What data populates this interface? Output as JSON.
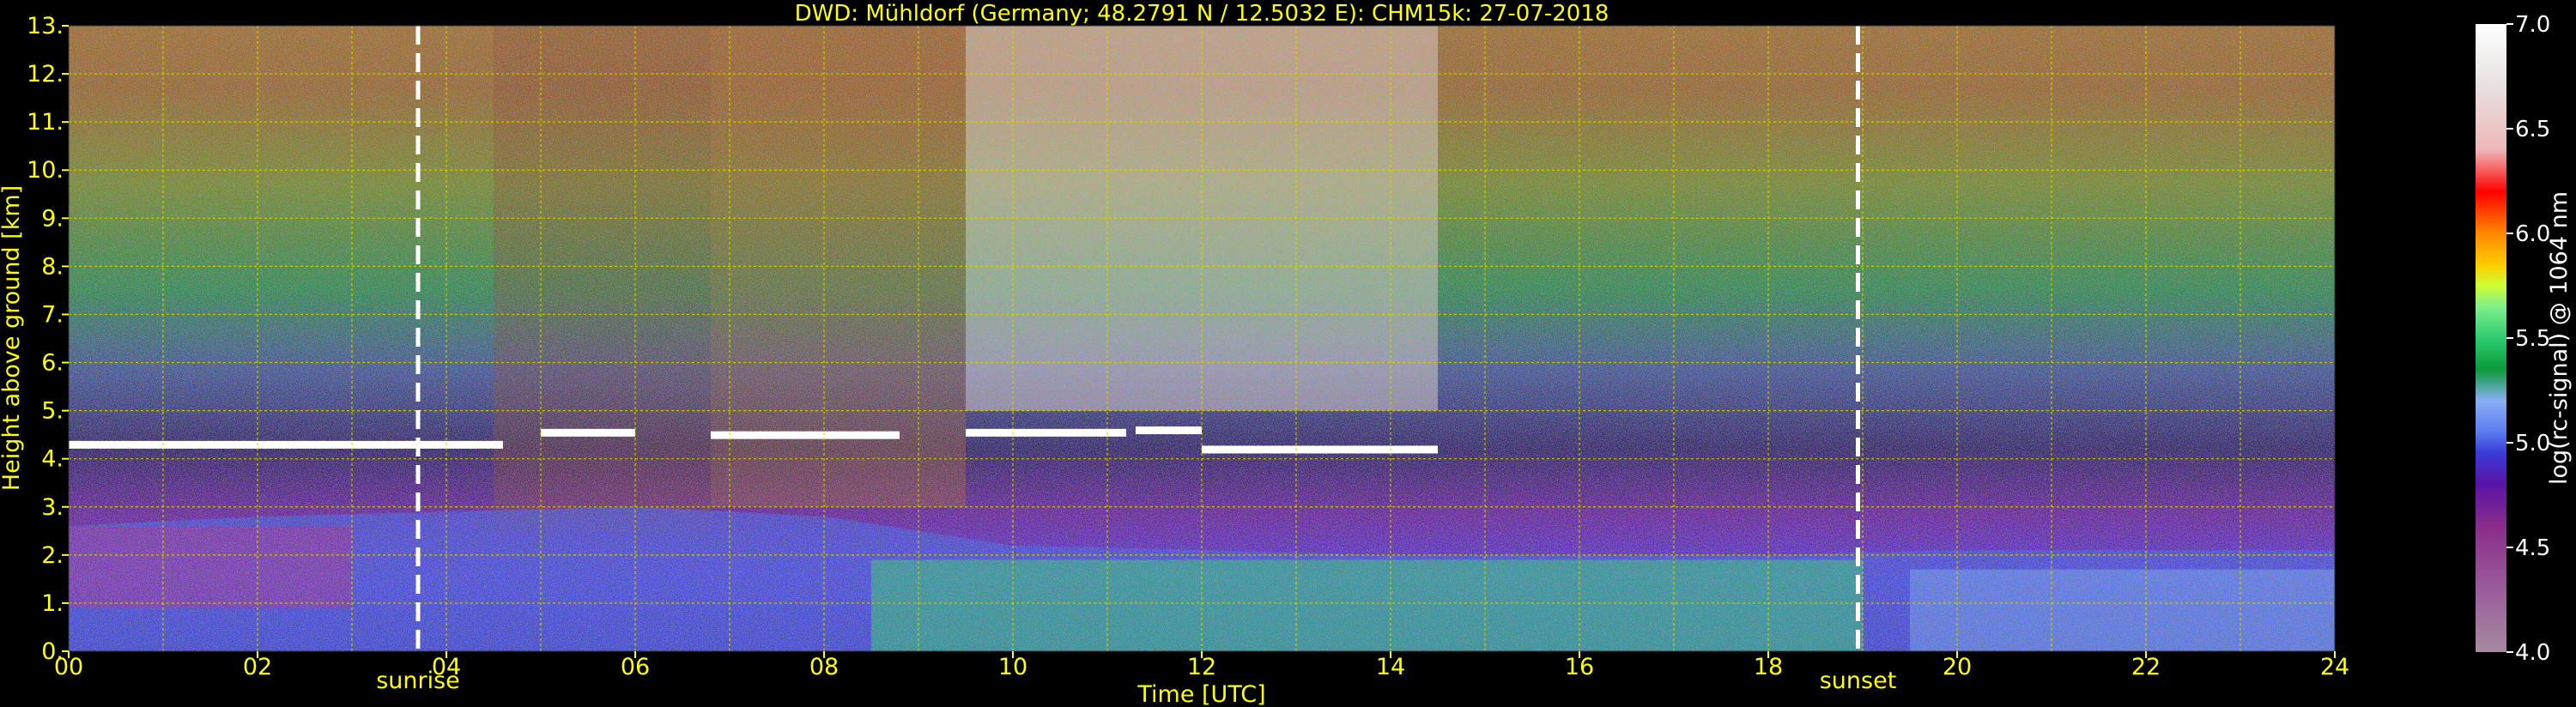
{
  "chart_data": {
    "type": "heatmap",
    "title": "DWD: Mühldorf (Germany; 48.2791 N / 12.5032 E):    CHM15k: 27-07-2018",
    "xlabel": "Time [UTC]",
    "ylabel": "Height above ground [km]",
    "colorbar_label": "log(rc-signal) @ 1064 nm",
    "xlim": [
      0,
      24
    ],
    "ylim": [
      0,
      13
    ],
    "x_ticks": [
      "00",
      "02",
      "04",
      "06",
      "08",
      "10",
      "12",
      "14",
      "16",
      "18",
      "20",
      "22",
      "24"
    ],
    "y_ticks": [
      "0.",
      "1.",
      "2.",
      "3.",
      "4.",
      "5.",
      "6.",
      "7.",
      "8.",
      "9.",
      "10.",
      "11.",
      "12.",
      "13."
    ],
    "colorbar_range": [
      4.0,
      7.0
    ],
    "colorbar_ticks": [
      "4.0",
      "4.5",
      "5.0",
      "5.5",
      "6.0",
      "6.5",
      "7.0"
    ],
    "grid": true,
    "events": [
      {
        "label": "sunrise",
        "x": 3.7
      },
      {
        "label": "sunset",
        "x": 18.95
      }
    ],
    "cloud_layers": [
      {
        "x_start": 0.0,
        "x_end": 4.6,
        "height": 4.3
      },
      {
        "x_start": 5.0,
        "x_end": 6.0,
        "height": 4.55
      },
      {
        "x_start": 6.8,
        "x_end": 8.8,
        "height": 4.5
      },
      {
        "x_start": 9.5,
        "x_end": 11.2,
        "height": 4.55
      },
      {
        "x_start": 11.3,
        "x_end": 12.0,
        "height": 4.6
      },
      {
        "x_start": 12.0,
        "x_end": 14.5,
        "height": 4.2
      }
    ],
    "boundary_layer": [
      {
        "x": 0,
        "top": 2.6
      },
      {
        "x": 2,
        "top": 2.8
      },
      {
        "x": 4,
        "top": 2.9
      },
      {
        "x": 6,
        "top": 3.0
      },
      {
        "x": 8,
        "top": 2.8
      },
      {
        "x": 10,
        "top": 2.2
      },
      {
        "x": 12,
        "top": 2.1
      },
      {
        "x": 14,
        "top": 2.0
      },
      {
        "x": 16,
        "top": 2.0
      },
      {
        "x": 18,
        "top": 2.0
      },
      {
        "x": 20,
        "top": 2.1
      },
      {
        "x": 22,
        "top": 2.1
      },
      {
        "x": 24,
        "top": 2.1
      }
    ],
    "colormap": [
      {
        "value": 4.0,
        "color": "#a68aa0"
      },
      {
        "value": 4.3,
        "color": "#9a5c9a"
      },
      {
        "value": 4.6,
        "color": "#8a2c8a"
      },
      {
        "value": 4.8,
        "color": "#5a14a6"
      },
      {
        "value": 4.95,
        "color": "#3a3ad8"
      },
      {
        "value": 5.05,
        "color": "#5a7cf0"
      },
      {
        "value": 5.2,
        "color": "#8aaef5"
      },
      {
        "value": 5.35,
        "color": "#0a9a3a"
      },
      {
        "value": 5.5,
        "color": "#2ecc71"
      },
      {
        "value": 5.65,
        "color": "#7ff08a"
      },
      {
        "value": 5.75,
        "color": "#ccff33"
      },
      {
        "value": 5.85,
        "color": "#ffcc00"
      },
      {
        "value": 6.0,
        "color": "#ff8800"
      },
      {
        "value": 6.2,
        "color": "#ff0000"
      },
      {
        "value": 6.4,
        "color": "#f0b8b8"
      },
      {
        "value": 6.7,
        "color": "#e8e0e0"
      },
      {
        "value": 7.0,
        "color": "#ffffff"
      }
    ]
  }
}
